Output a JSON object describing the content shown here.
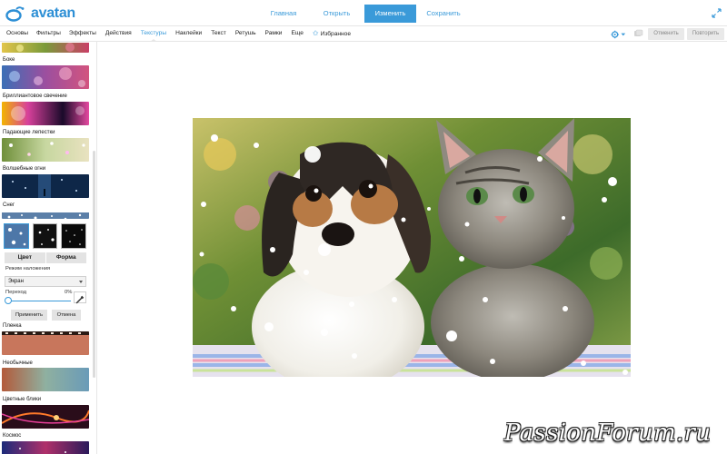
{
  "app": {
    "logo_text": "avatan"
  },
  "nav": {
    "items": [
      {
        "label": "Главная"
      },
      {
        "label": "Открыть"
      },
      {
        "label": "Изменить"
      },
      {
        "label": "Сохранить"
      }
    ],
    "active": "Изменить"
  },
  "menu": {
    "items": [
      "Основы",
      "Фильтры",
      "Эффекты",
      "Действия",
      "Текстуры",
      "Наклейки",
      "Текст",
      "Ретушь",
      "Рамки",
      "Еще",
      "Избранное"
    ],
    "active": "Текстуры",
    "undo_label": "Отменить",
    "redo_label": "Повторить"
  },
  "panel": {
    "textures": [
      {
        "label": "Боке"
      },
      {
        "label": "Бриллиантовое свечение"
      },
      {
        "label": "Падающие лепестки"
      },
      {
        "label": "Волшебные огни"
      },
      {
        "label": "Снег"
      },
      {
        "label": "Пленка"
      },
      {
        "label": "Необычные"
      },
      {
        "label": "Цветные блики"
      },
      {
        "label": "Космос"
      }
    ],
    "snow": {
      "tab_color": "Цвет",
      "tab_shape": "Форма",
      "blend_mode_label": "Режим наложения",
      "blend_mode_value": "Экран",
      "transition_label": "Переход",
      "transition_value": "0%",
      "transition_fraction": 0,
      "apply_label": "Применить",
      "cancel_label": "Отмена"
    }
  },
  "watermark": "PassionForum.ru",
  "colors": {
    "accent": "#3a9ad9",
    "logo": "#2d8fd5"
  },
  "icons": [
    "fullscreen-icon",
    "settings-gear-icon",
    "history-icon",
    "star-icon",
    "eyedropper-icon",
    "chevron-down-icon"
  ]
}
